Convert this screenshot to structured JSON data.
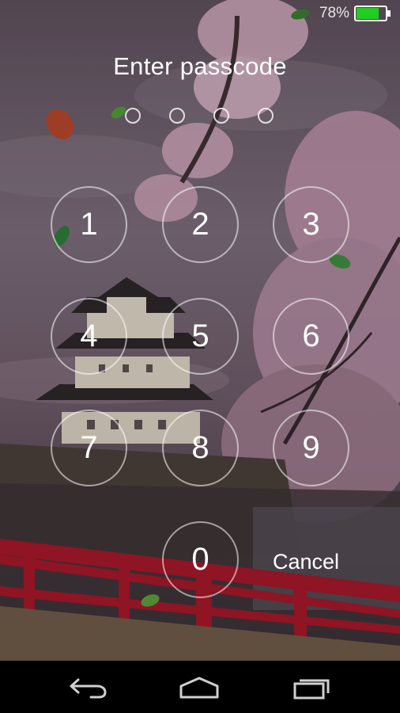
{
  "status_bar": {
    "battery_percent_text": "78%",
    "battery_level": 0.78,
    "battery_color": "#22cc22"
  },
  "lock_screen": {
    "title": "Enter passcode",
    "entered_digits": 0,
    "total_digits": 4,
    "keys": [
      "1",
      "2",
      "3",
      "4",
      "5",
      "6",
      "7",
      "8",
      "9",
      "0"
    ],
    "cancel_label": "Cancel"
  },
  "navigation": {
    "back_icon": "back-arrow-icon",
    "home_icon": "home-icon",
    "recents_icon": "recent-apps-icon"
  },
  "colors": {
    "sky": "#6e5e6c",
    "blossom": "#d9b6c8",
    "bridge": "#a0182a"
  }
}
